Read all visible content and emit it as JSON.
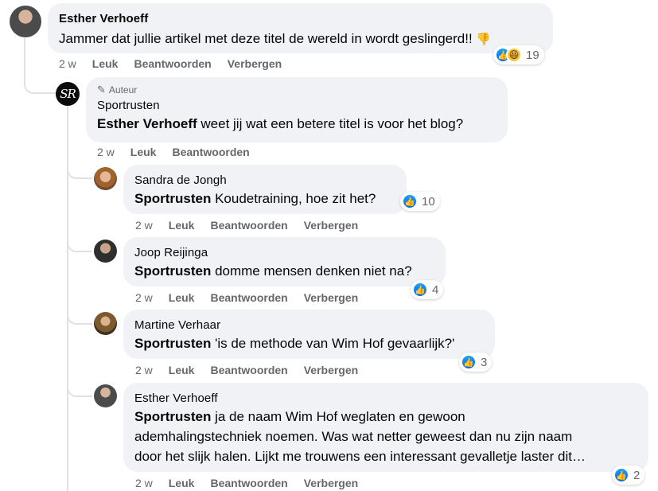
{
  "comments": {
    "c1": {
      "author": "Esther Verhoeff",
      "text": "Jammer dat jullie artikel met deze titel de wereld in wordt geslingerd!!",
      "emoji": "👎",
      "time": "2 w",
      "like": "Leuk",
      "reply": "Beantwoorden",
      "hide": "Verbergen",
      "reaction_count": "19"
    },
    "c2": {
      "badge": "Auteur",
      "avatar_text": "SR",
      "author": "Sportrusten",
      "mention": "Esther Verhoeff",
      "text": " weet jij wat een betere titel is voor het blog?",
      "time": "2 w",
      "like": "Leuk",
      "reply": "Beantwoorden"
    },
    "c3": {
      "author": "Sandra de Jongh",
      "mention": "Sportrusten",
      "text": " Koudetraining, hoe zit het?",
      "time": "2 w",
      "like": "Leuk",
      "reply": "Beantwoorden",
      "hide": "Verbergen",
      "reaction_count": "10"
    },
    "c4": {
      "author": "Joop Reijinga",
      "mention": "Sportrusten",
      "text": " domme mensen denken niet na?",
      "time": "2 w",
      "like": "Leuk",
      "reply": "Beantwoorden",
      "hide": "Verbergen",
      "reaction_count": "4"
    },
    "c5": {
      "author": "Martine Verhaar",
      "mention": "Sportrusten",
      "text": " 'is de methode van Wim Hof gevaarlijk?'",
      "time": "2 w",
      "like": "Leuk",
      "reply": "Beantwoorden",
      "hide": "Verbergen",
      "reaction_count": "3"
    },
    "c6": {
      "author": "Esther Verhoeff",
      "mention": "Sportrusten",
      "text_line1": " ja de naam Wim Hof weglaten en gewoon",
      "text_line2": "ademhalingstechniek noemen. Was wat netter geweest dan nu zijn naam",
      "text_line3": "door het slijk halen. Lijkt me trouwens een interessant gevalletje laster dit…",
      "time": "2 w",
      "like": "Leuk",
      "reply": "Beantwoorden",
      "hide": "Verbergen",
      "reaction_count": "2"
    }
  },
  "icons": {
    "like": "thumbs-up-icon",
    "haha": "haha-emoji-icon",
    "pencil": "pencil-icon"
  },
  "colors": {
    "bubble": "#f0f2f5",
    "like_blue": "#0866ff",
    "secondary_text": "#65676b",
    "thread_line": "#dfe1e5"
  }
}
